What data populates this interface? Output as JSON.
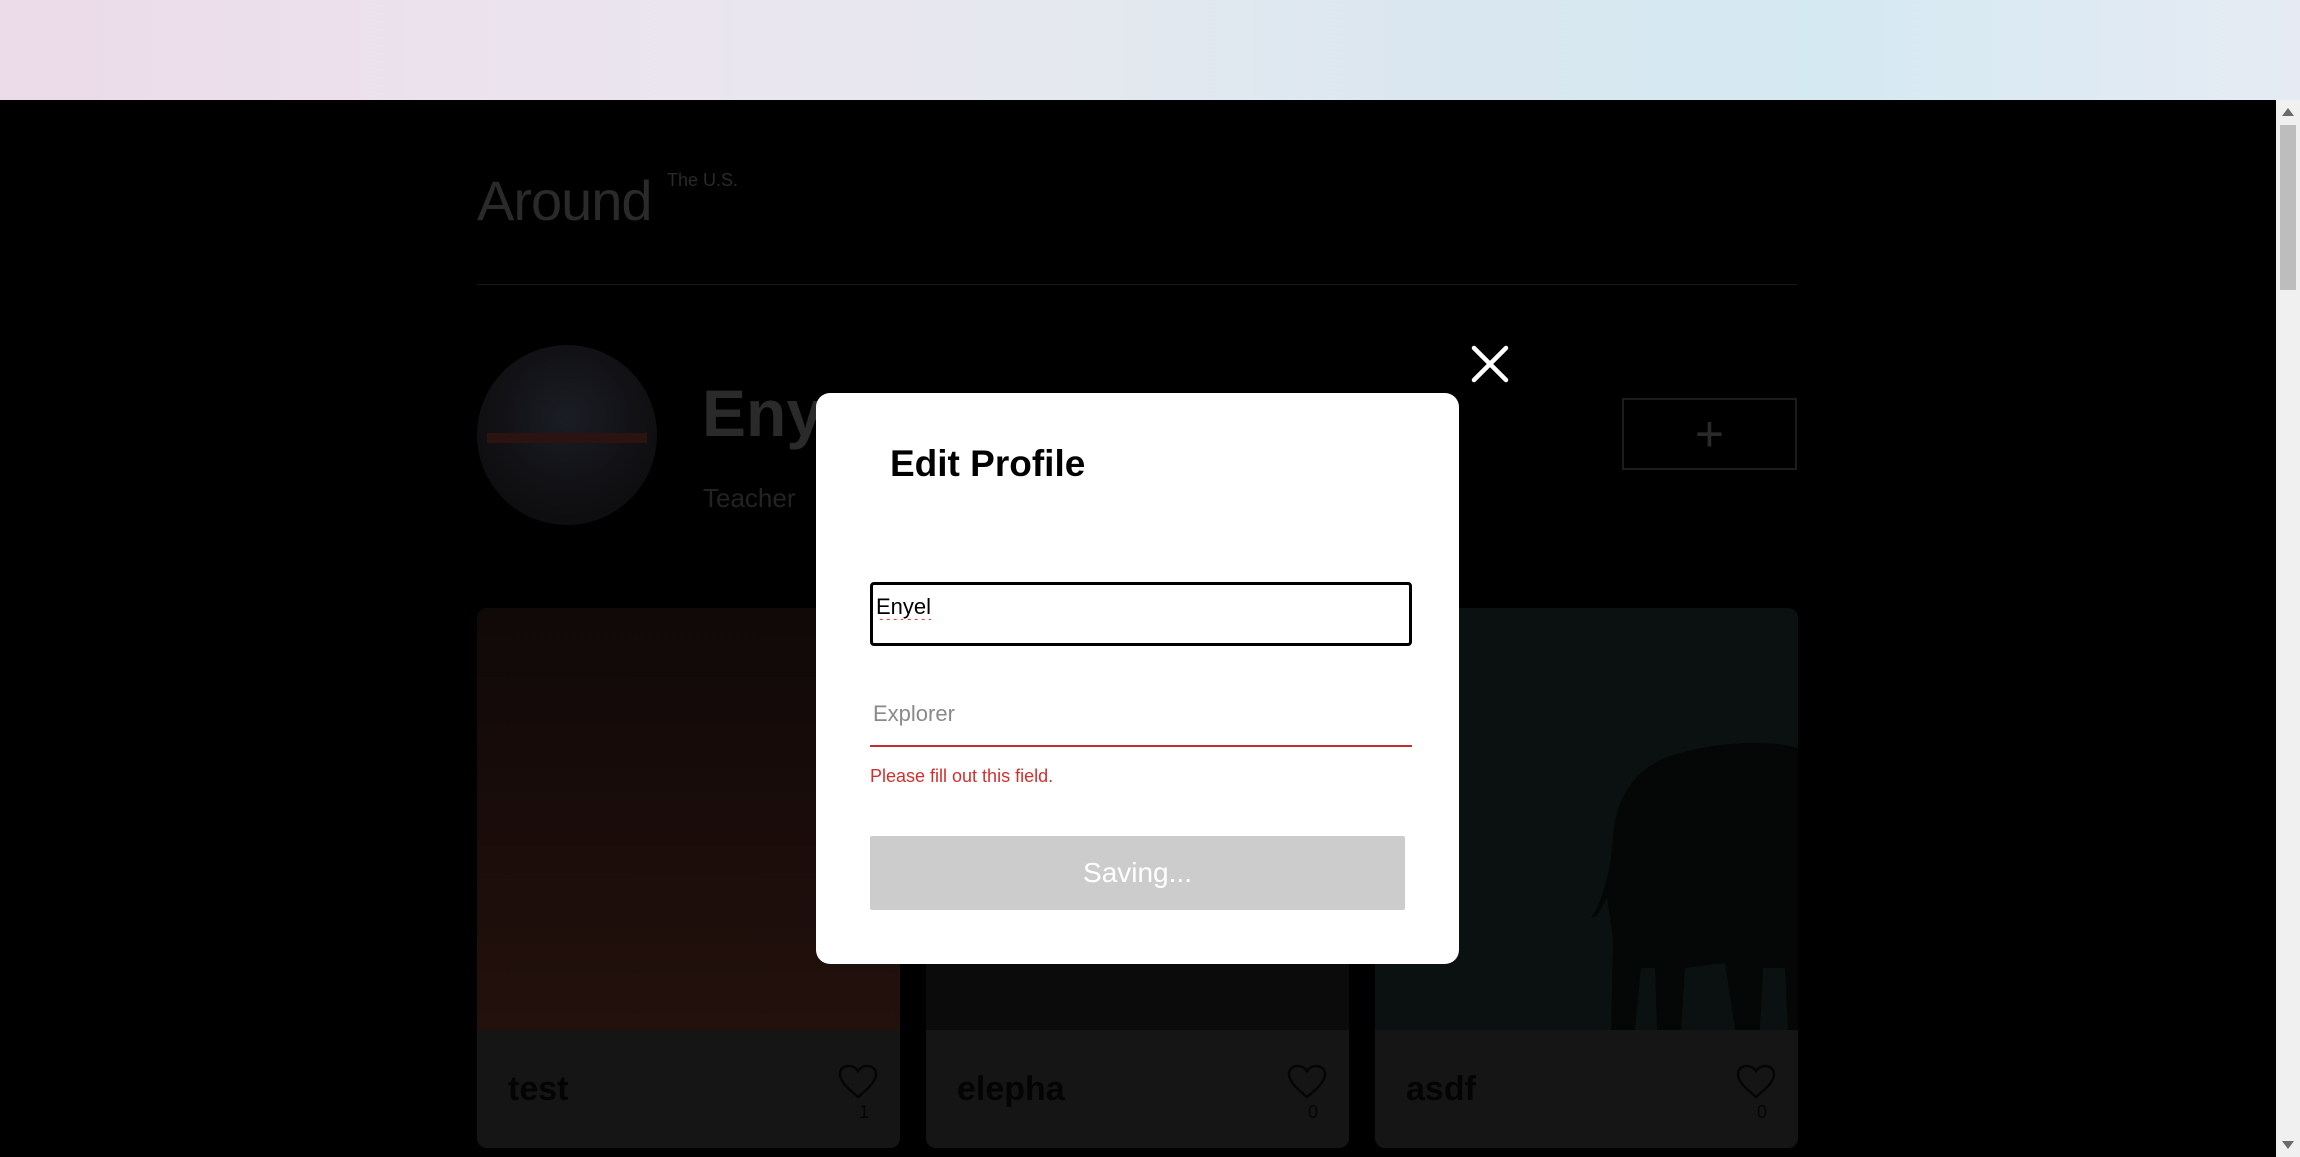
{
  "site": {
    "logo_main": "Around",
    "logo_sup": "The U.S."
  },
  "profile": {
    "name": "Eny",
    "about": "Teacher",
    "add_button": "+"
  },
  "cards": [
    {
      "title": "test",
      "likes": "1"
    },
    {
      "title": "elepha",
      "likes": "0"
    },
    {
      "title": "asdf",
      "likes": "0"
    }
  ],
  "modal": {
    "title": "Edit Profile",
    "name_value": "Enyel",
    "about_value": "",
    "about_placeholder": "Explorer",
    "error_message": "Please fill out this field.",
    "save_label": "Saving..."
  },
  "colors": {
    "error": "#d2302e",
    "button_disabled": "#cccccc",
    "overlay": "#000000"
  },
  "icons": {
    "close": "close-icon",
    "like": "heart-icon",
    "add": "plus-icon"
  }
}
